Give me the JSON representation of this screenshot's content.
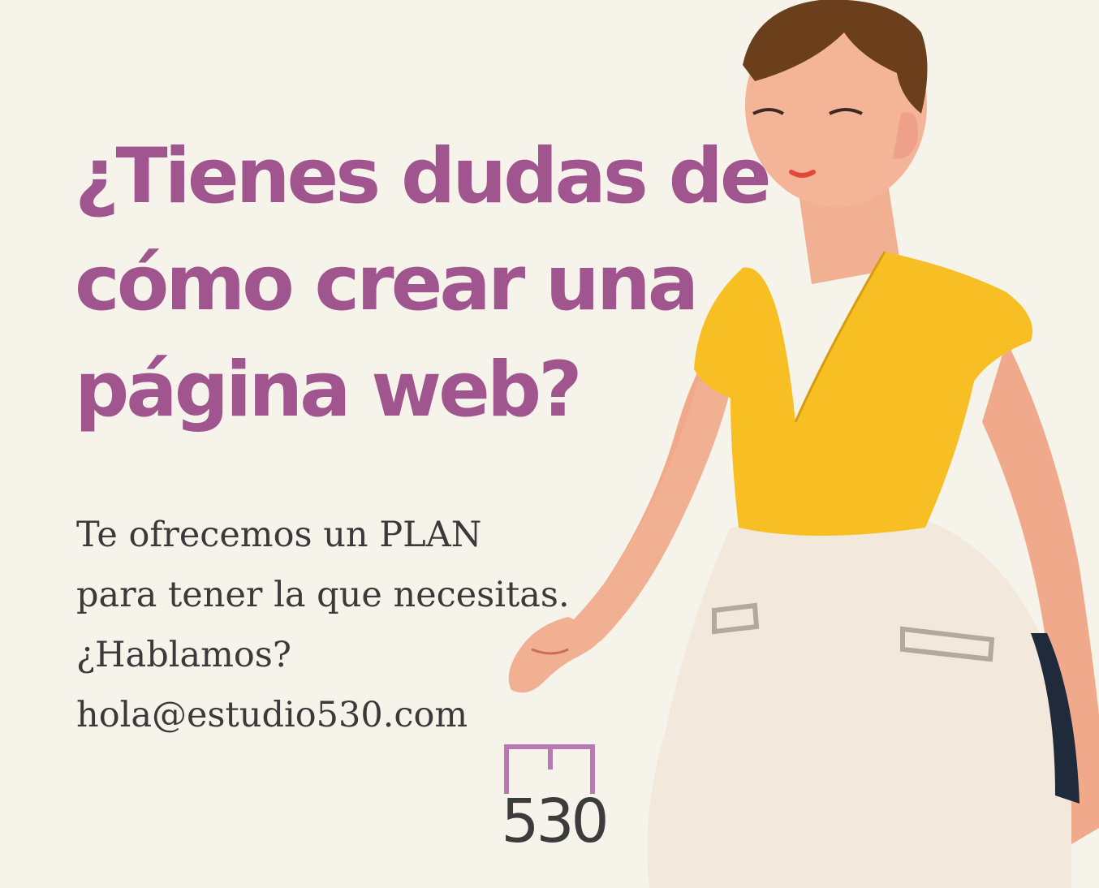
{
  "headline": {
    "line1": "¿Tienes dudas de",
    "line2": "cómo crear una",
    "line3": "página web?"
  },
  "body": {
    "line1": "Te ofrecemos un PLAN",
    "line2": "para tener la que necesitas.",
    "line3": "¿Hablamos?",
    "email": "hola@estudio530.com"
  },
  "logo": {
    "text": "530",
    "accent_color": "#b878b0"
  },
  "colors": {
    "background": "#f6f3ea",
    "headline": "#a0558f",
    "body_text": "#3a3a3a",
    "shirt": "#f7bf24",
    "pants": "#f2e9dc",
    "skin": "#f4b497",
    "hair": "#6b3f1c"
  }
}
